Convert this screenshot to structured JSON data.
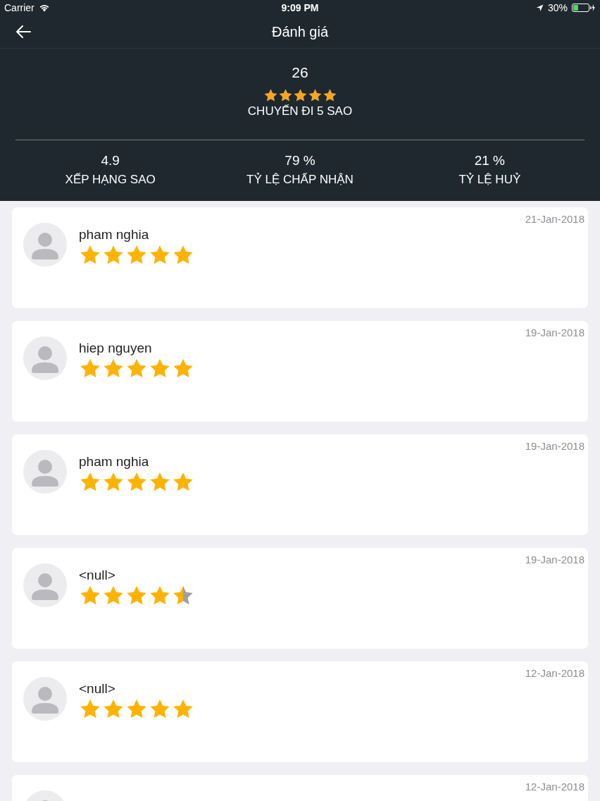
{
  "status_bar": {
    "carrier": "Carrier",
    "time": "9:09 PM",
    "battery": "30%"
  },
  "header": {
    "title": "Đánh giá"
  },
  "summary": {
    "count": "26",
    "stars": 5,
    "label": "CHUYẾN ĐI 5 SAO"
  },
  "stats": [
    {
      "value": "4.9",
      "label": "XẾP HẠNG SAO"
    },
    {
      "value": "79 %",
      "label": "TỶ LỆ CHẤP NHẬN"
    },
    {
      "value": "21 %",
      "label": "TỶ LỆ HUỶ"
    }
  ],
  "reviews": [
    {
      "name": "pham nghia",
      "stars": 5,
      "date": "21-Jan-2018"
    },
    {
      "name": "hiep nguyen",
      "stars": 5,
      "date": "19-Jan-2018"
    },
    {
      "name": "pham nghia",
      "stars": 5,
      "date": "19-Jan-2018"
    },
    {
      "name": "<null>",
      "stars": 4.5,
      "date": "19-Jan-2018"
    },
    {
      "name": "<null>",
      "stars": 5,
      "date": "12-Jan-2018"
    },
    {
      "date": "12-Jan-2018"
    }
  ]
}
